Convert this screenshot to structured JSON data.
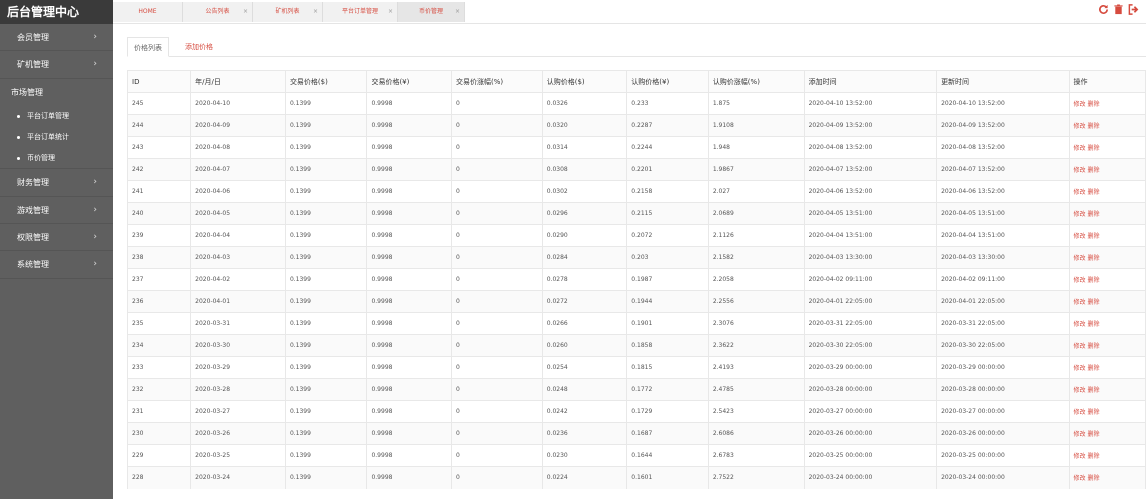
{
  "app": {
    "title": "后台管理中心"
  },
  "sidebar": {
    "items": [
      {
        "label": "会员管理",
        "has_children": true
      },
      {
        "label": "矿机管理",
        "has_children": true
      },
      {
        "label": "市场管理",
        "has_children": false,
        "expanded": true
      },
      {
        "label": "财务管理",
        "has_children": true
      },
      {
        "label": "游戏管理",
        "has_children": true
      },
      {
        "label": "权限管理",
        "has_children": true
      },
      {
        "label": "系统管理",
        "has_children": true
      }
    ],
    "sub_items": [
      "平台订单管理",
      "平台订单统计",
      "币价管理"
    ]
  },
  "top_tabs": [
    "HOME",
    "公告列表",
    "矿机列表",
    "平台订单管理",
    "币价管理"
  ],
  "inner_tabs": {
    "list": "价格列表",
    "add": "添加价格"
  },
  "table": {
    "headers": [
      "ID",
      "年/月/日",
      "交易价格($)",
      "交易价格(¥)",
      "交易价涨幅(%)",
      "认购价格($)",
      "认购价格(¥)",
      "认购价涨幅(%)",
      "添加时间",
      "更新时间",
      "操作"
    ],
    "action_edit": "修改",
    "action_delete": "删除",
    "rows": [
      [
        "245",
        "2020-04-10",
        "0.1399",
        "0.9998",
        "0",
        "0.0326",
        "0.233",
        "1.875",
        "2020-04-10 13:52:00",
        "2020-04-10 13:52:00"
      ],
      [
        "244",
        "2020-04-09",
        "0.1399",
        "0.9998",
        "0",
        "0.0320",
        "0.2287",
        "1.9108",
        "2020-04-09 13:52:00",
        "2020-04-09 13:52:00"
      ],
      [
        "243",
        "2020-04-08",
        "0.1399",
        "0.9998",
        "0",
        "0.0314",
        "0.2244",
        "1.948",
        "2020-04-08 13:52:00",
        "2020-04-08 13:52:00"
      ],
      [
        "242",
        "2020-04-07",
        "0.1399",
        "0.9998",
        "0",
        "0.0308",
        "0.2201",
        "1.9867",
        "2020-04-07 13:52:00",
        "2020-04-07 13:52:00"
      ],
      [
        "241",
        "2020-04-06",
        "0.1399",
        "0.9998",
        "0",
        "0.0302",
        "0.2158",
        "2.027",
        "2020-04-06 13:52:00",
        "2020-04-06 13:52:00"
      ],
      [
        "240",
        "2020-04-05",
        "0.1399",
        "0.9998",
        "0",
        "0.0296",
        "0.2115",
        "2.0689",
        "2020-04-05 13:51:00",
        "2020-04-05 13:51:00"
      ],
      [
        "239",
        "2020-04-04",
        "0.1399",
        "0.9998",
        "0",
        "0.0290",
        "0.2072",
        "2.1126",
        "2020-04-04 13:51:00",
        "2020-04-04 13:51:00"
      ],
      [
        "238",
        "2020-04-03",
        "0.1399",
        "0.9998",
        "0",
        "0.0284",
        "0.203",
        "2.1582",
        "2020-04-03 13:30:00",
        "2020-04-03 13:30:00"
      ],
      [
        "237",
        "2020-04-02",
        "0.1399",
        "0.9998",
        "0",
        "0.0278",
        "0.1987",
        "2.2058",
        "2020-04-02 09:11:00",
        "2020-04-02 09:11:00"
      ],
      [
        "236",
        "2020-04-01",
        "0.1399",
        "0.9998",
        "0",
        "0.0272",
        "0.1944",
        "2.2556",
        "2020-04-01 22:05:00",
        "2020-04-01 22:05:00"
      ],
      [
        "235",
        "2020-03-31",
        "0.1399",
        "0.9998",
        "0",
        "0.0266",
        "0.1901",
        "2.3076",
        "2020-03-31 22:05:00",
        "2020-03-31 22:05:00"
      ],
      [
        "234",
        "2020-03-30",
        "0.1399",
        "0.9998",
        "0",
        "0.0260",
        "0.1858",
        "2.3622",
        "2020-03-30 22:05:00",
        "2020-03-30 22:05:00"
      ],
      [
        "233",
        "2020-03-29",
        "0.1399",
        "0.9998",
        "0",
        "0.0254",
        "0.1815",
        "2.4193",
        "2020-03-29 00:00:00",
        "2020-03-29 00:00:00"
      ],
      [
        "232",
        "2020-03-28",
        "0.1399",
        "0.9998",
        "0",
        "0.0248",
        "0.1772",
        "2.4785",
        "2020-03-28 00:00:00",
        "2020-03-28 00:00:00"
      ],
      [
        "231",
        "2020-03-27",
        "0.1399",
        "0.9998",
        "0",
        "0.0242",
        "0.1729",
        "2.5423",
        "2020-03-27 00:00:00",
        "2020-03-27 00:00:00"
      ],
      [
        "230",
        "2020-03-26",
        "0.1399",
        "0.9998",
        "0",
        "0.0236",
        "0.1687",
        "2.6086",
        "2020-03-26 00:00:00",
        "2020-03-26 00:00:00"
      ],
      [
        "229",
        "2020-03-25",
        "0.1399",
        "0.9998",
        "0",
        "0.0230",
        "0.1644",
        "2.6783",
        "2020-03-25 00:00:00",
        "2020-03-25 00:00:00"
      ],
      [
        "228",
        "2020-03-24",
        "0.1399",
        "0.9998",
        "0",
        "0.0224",
        "0.1601",
        "2.7522",
        "2020-03-24 00:00:00",
        "2020-03-24 00:00:00"
      ]
    ]
  },
  "colors": {
    "accent": "#d64b3f",
    "sidebar": "#5f5f5f",
    "brand_bar": "#3a3a3a"
  },
  "icons": {
    "refresh": "refresh-icon",
    "trash": "trash-icon",
    "logout": "logout-icon"
  }
}
